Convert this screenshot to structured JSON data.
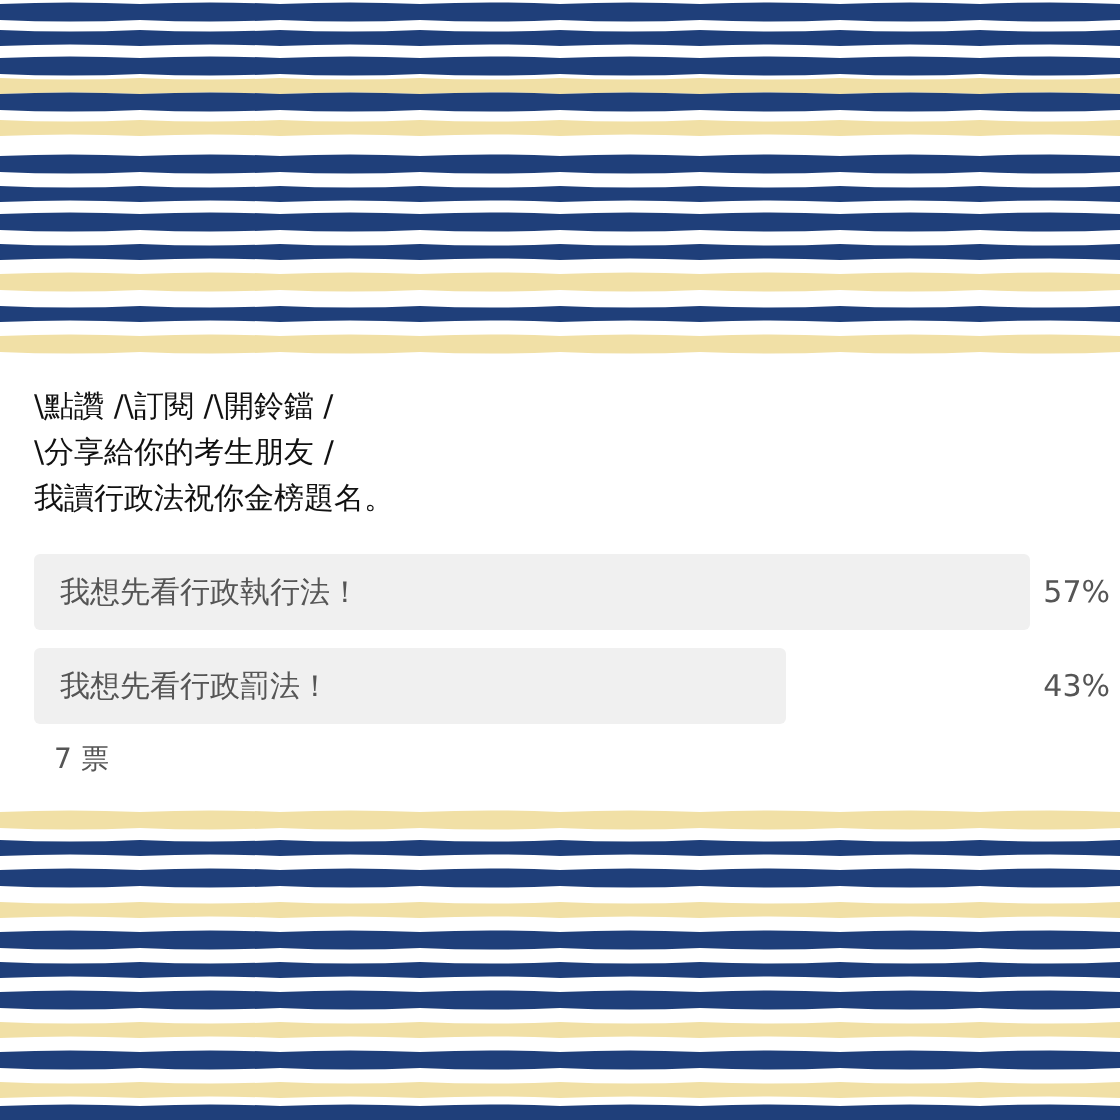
{
  "post_text": [
    "\\點讚 /\\訂閱 /\\開鈴鐺 /",
    "\\分享給你的考生朋友 /",
    "我讀行政法祝你金榜題名。"
  ],
  "poll": {
    "options": [
      {
        "label": "我想先看行政執行法！",
        "percent": "57%"
      },
      {
        "label": "我想先看行政罰法！",
        "percent": "43%"
      }
    ],
    "votes": "7 票"
  }
}
